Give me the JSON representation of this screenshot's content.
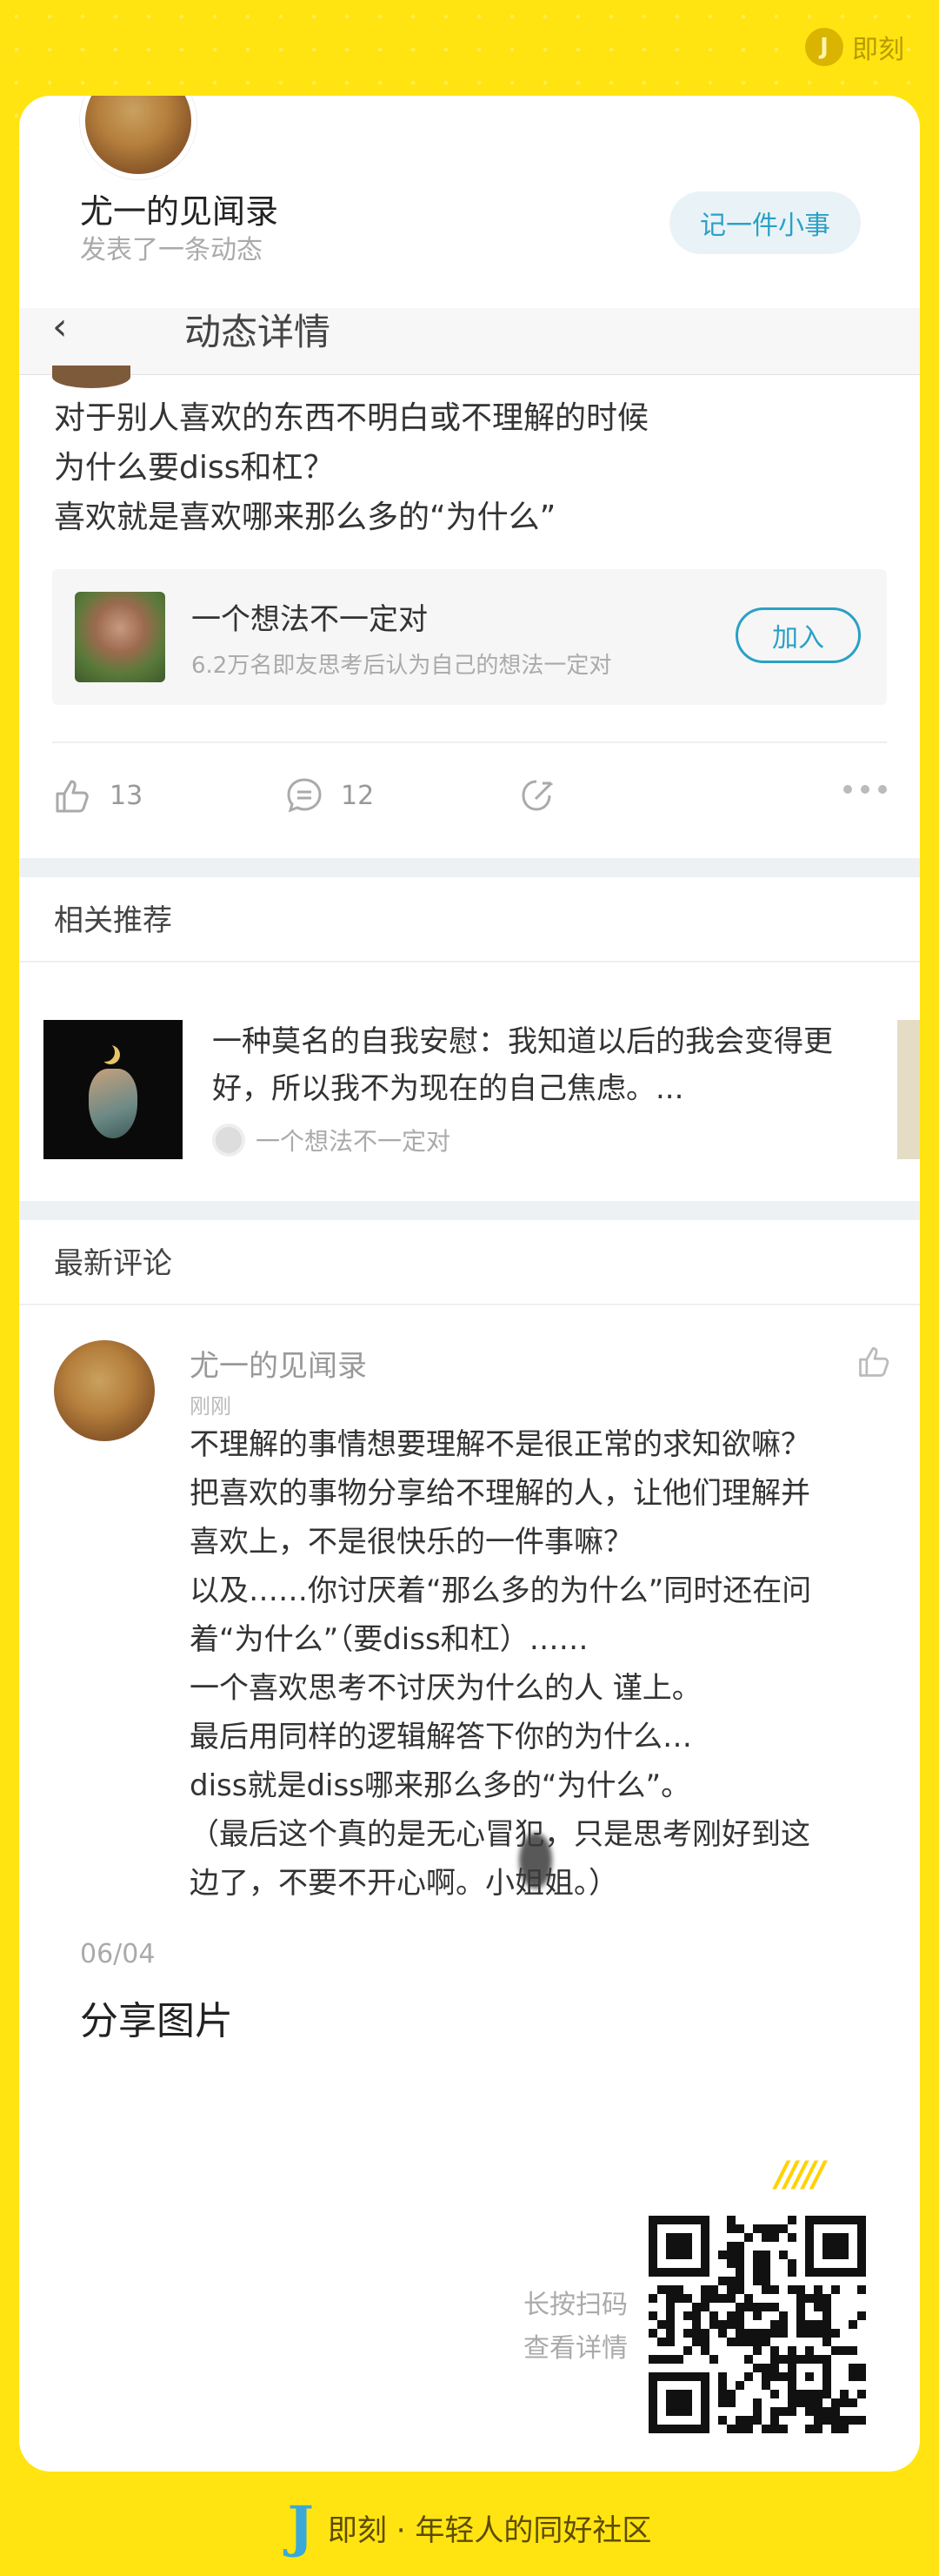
{
  "brand": {
    "top_label": "即刻",
    "logo_letter": "J",
    "footer_text": "即刻 · 年轻人的同好社区"
  },
  "author": {
    "name": "尤一的见闻录",
    "action": "发表了一条动态",
    "button": "记一件小事"
  },
  "screen": {
    "nav_title": "动态详情",
    "post_lines": [
      "对于别人喜欢的东西不明白或不理解的时候",
      "为什么要diss和杠？",
      "喜欢就是喜欢哪来那么多的“为什么”"
    ],
    "topic": {
      "name": "一个想法不一定对",
      "desc": "6.2万名即友思考后认为自己的想法一定对",
      "join": "加入"
    },
    "actions": {
      "likes": "13",
      "comments": "12"
    },
    "related": {
      "title": "相关推荐",
      "text": "一种莫名的自我安慰：我知道以后的我会变得更好，所以我不为现在的自己焦虑。...",
      "topic": "一个想法不一定对"
    },
    "comments": {
      "title": "最新评论",
      "name": "尤一的见闻录",
      "time": "刚刚",
      "lines": [
        "不理解的事情想要理解不是很正常的求知欲嘛？",
        "把喜欢的事物分享给不理解的人，让他们理解并",
        "喜欢上，不是很快乐的一件事嘛？",
        "以及……你讨厌着“那么多的为什么”同时还在问",
        "着“为什么”（要diss和杠）……",
        "一个喜欢思考不讨厌为什么的人 谨上。",
        "最后用同样的逻辑解答下你的为什么…",
        "diss就是diss哪来那么多的“为什么”。",
        "（最后这个真的是无心冒犯，只是思考刚好到这",
        "边了，不要不开心啊。小姐姐。）"
      ]
    }
  },
  "share": {
    "date": "06/04",
    "title": "分享图片",
    "slashes": "/////",
    "scan_line1": "长按扫码",
    "scan_line2": "查看详情"
  }
}
